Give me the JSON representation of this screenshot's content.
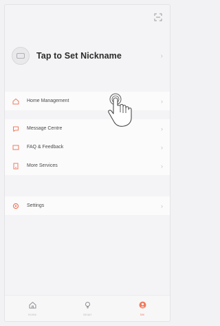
{
  "header": {
    "scan_icon": "scan-icon"
  },
  "profile": {
    "nickname": "Tap to Set Nickname",
    "avatar_icon": "avatar-icon"
  },
  "menu": {
    "items": [
      {
        "label": "Home Management",
        "icon": "home-icon"
      },
      {
        "label": "Message Centre",
        "icon": "message-icon"
      },
      {
        "label": "FAQ & Feedback",
        "icon": "faq-icon"
      },
      {
        "label": "More Services",
        "icon": "services-icon"
      }
    ],
    "settings": {
      "label": "Settings",
      "icon": "settings-icon"
    }
  },
  "tabbar": {
    "tabs": [
      {
        "label": "Home",
        "icon": "home-tab-icon",
        "active": false
      },
      {
        "label": "Smart",
        "icon": "smart-tab-icon",
        "active": false
      },
      {
        "label": "Me",
        "icon": "me-tab-icon",
        "active": true
      }
    ]
  },
  "colors": {
    "accent": "#f07a5e",
    "background": "#f4f4f6",
    "text": "#2b2b2b"
  }
}
